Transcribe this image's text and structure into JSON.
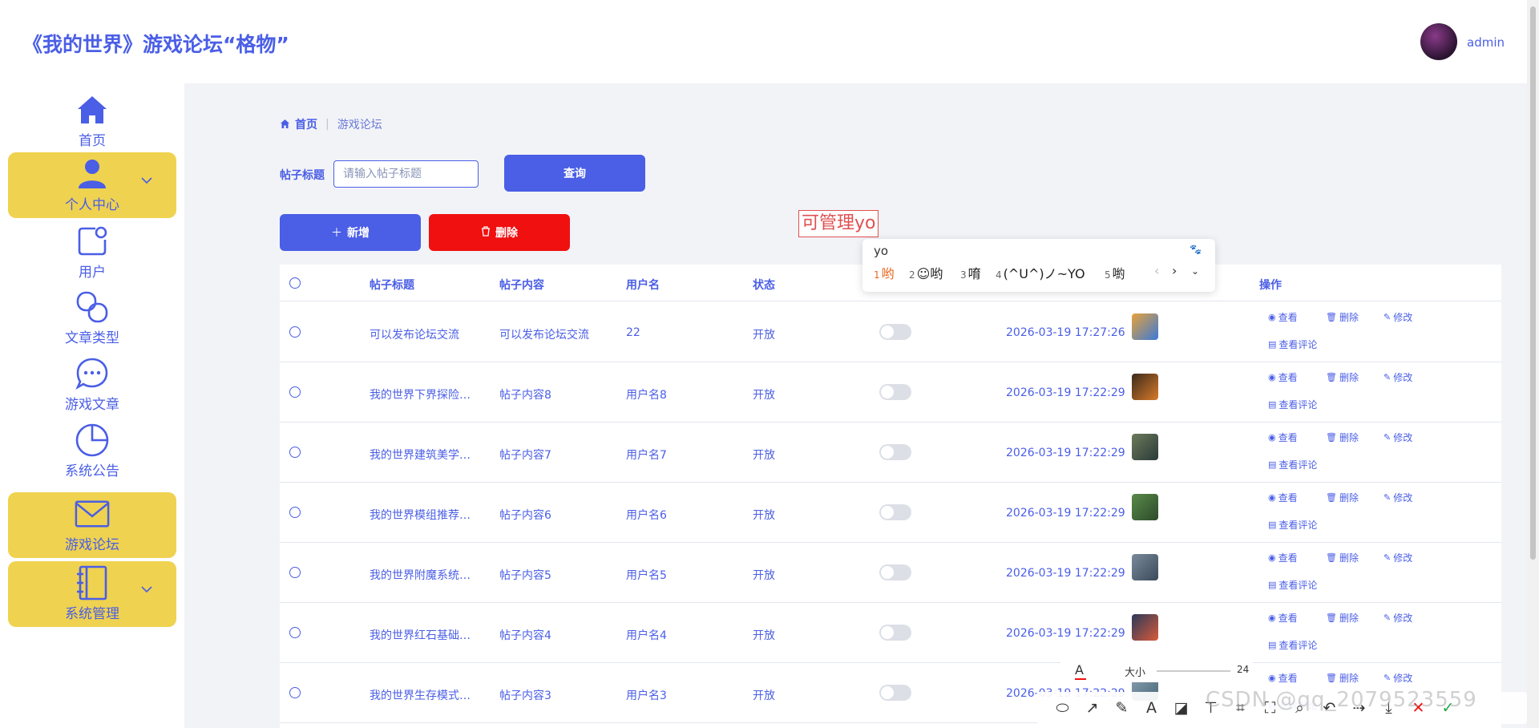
{
  "header": {
    "site_title": "《我的世界》游戏论坛“格物”",
    "admin_name": "admin"
  },
  "sidebar": {
    "items": [
      {
        "label": "首页",
        "icon": "home-icon"
      },
      {
        "label": "个人中心",
        "icon": "user-icon",
        "expandable": true
      },
      {
        "label": "用户",
        "icon": "user-card-icon"
      },
      {
        "label": "文章类型",
        "icon": "link-icon"
      },
      {
        "label": "游戏文章",
        "icon": "chat-bubble-icon"
      },
      {
        "label": "系统公告",
        "icon": "pie-chart-icon"
      },
      {
        "label": "游戏论坛",
        "icon": "mail-icon"
      },
      {
        "label": "系统管理",
        "icon": "notebook-icon",
        "expandable": true
      }
    ]
  },
  "breadcrumb": {
    "home": "首页",
    "current": "游戏论坛"
  },
  "search": {
    "label": "帖子标题",
    "placeholder": "请输入帖子标题",
    "query_button": "查询"
  },
  "actions": {
    "add_button": "新增",
    "delete_button": "删除"
  },
  "table": {
    "headers": {
      "title": "帖子标题",
      "content": "帖子内容",
      "username": "用户名",
      "status": "状态",
      "operations": "操作"
    },
    "row_actions": {
      "view": "查看",
      "delete": "删除",
      "edit": "修改",
      "view_comments": "查看评论"
    },
    "rows": [
      {
        "title": "可以发布论坛交流",
        "content": "可以发布论坛交流",
        "username": "22",
        "status": "开放",
        "time": "2026-03-19 17:27:26"
      },
      {
        "title": "我的世界下界探险…",
        "content": "帖子内容8",
        "username": "用户名8",
        "status": "开放",
        "time": "2026-03-19 17:22:29"
      },
      {
        "title": "我的世界建筑美学…",
        "content": "帖子内容7",
        "username": "用户名7",
        "status": "开放",
        "time": "2026-03-19 17:22:29"
      },
      {
        "title": "我的世界模组推荐…",
        "content": "帖子内容6",
        "username": "用户名6",
        "status": "开放",
        "time": "2026-03-19 17:22:29"
      },
      {
        "title": "我的世界附魔系统…",
        "content": "帖子内容5",
        "username": "用户名5",
        "status": "开放",
        "time": "2026-03-19 17:22:29"
      },
      {
        "title": "我的世界红石基础…",
        "content": "帖子内容4",
        "username": "用户名4",
        "status": "开放",
        "time": "2026-03-19 17:22:29"
      },
      {
        "title": "我的世界生存模式…",
        "content": "帖子内容3",
        "username": "用户名3",
        "status": "开放",
        "time": "2026-03-19 17:22:29"
      }
    ]
  },
  "ime": {
    "composing_text": "可管理yo",
    "input": "yo",
    "candidates": [
      {
        "num": "1",
        "text": "哟"
      },
      {
        "num": "2",
        "text": "☺哟"
      },
      {
        "num": "3",
        "text": "唷"
      },
      {
        "num": "4",
        "text": "(^U^)ノ~YO"
      },
      {
        "num": "5",
        "text": "喲"
      }
    ]
  },
  "screenshot_tool": {
    "size_label": "大小",
    "size_value": "24",
    "watermark": "CSDN @qq_2079523559"
  },
  "colors": {
    "accent": "#4a5ee6",
    "sidebar_highlight": "#efd24f",
    "danger": "#f01010",
    "content_bg": "#f2f3f7"
  }
}
